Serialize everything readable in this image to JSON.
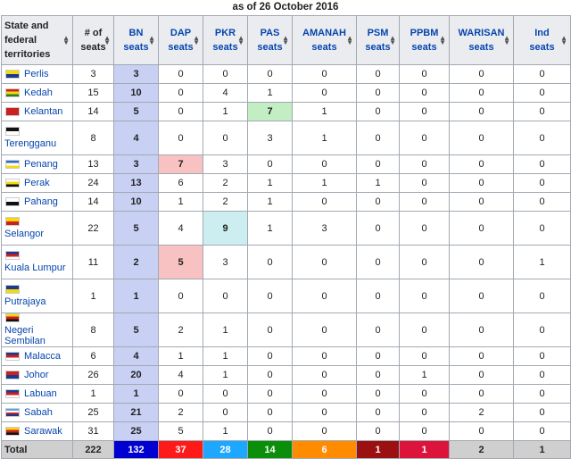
{
  "caption": "as of 26 October 2016",
  "header": {
    "state": [
      "State and",
      "federal",
      "territories"
    ],
    "num": [
      "# of",
      "seats"
    ],
    "parties": [
      {
        "key": "bn",
        "l1": "BN",
        "l2": "seats"
      },
      {
        "key": "dap",
        "l1": "DAP",
        "l2": "seats"
      },
      {
        "key": "pkr",
        "l1": "PKR",
        "l2": "seats"
      },
      {
        "key": "pas",
        "l1": "PAS",
        "l2": "seats"
      },
      {
        "key": "amanah",
        "l1": "AMANAH",
        "l2": "seats"
      },
      {
        "key": "psm",
        "l1": "PSM",
        "l2": "seats"
      },
      {
        "key": "ppbm",
        "l1": "PPBM",
        "l2": "seats"
      },
      {
        "key": "warisan",
        "l1": "WARISAN",
        "l2": "seats"
      },
      {
        "key": "ind",
        "l1": "Ind",
        "l2": "seats"
      }
    ],
    "sort_icon": "sort-arrows-icon"
  },
  "rows": [
    {
      "state": "Perlis",
      "flag": [
        "#f5d90a",
        "#1a3a8f"
      ],
      "seats": "3",
      "bn": "3",
      "dap": "0",
      "pkr": "0",
      "pas": "0",
      "amanah": "0",
      "psm": "0",
      "ppbm": "0",
      "warisan": "0",
      "ind": "0",
      "win": "bn"
    },
    {
      "state": "Kedah",
      "flag": [
        "#d22020",
        "#f5d90a",
        "#2c7d2c"
      ],
      "seats": "15",
      "bn": "10",
      "dap": "0",
      "pkr": "4",
      "pas": "1",
      "amanah": "0",
      "psm": "0",
      "ppbm": "0",
      "warisan": "0",
      "ind": "0",
      "win": "bn"
    },
    {
      "state": "Kelantan",
      "flag": [
        "#cc1f1f"
      ],
      "seats": "14",
      "bn": "5",
      "dap": "0",
      "pkr": "1",
      "pas": "7",
      "amanah": "1",
      "psm": "0",
      "ppbm": "0",
      "warisan": "0",
      "ind": "0",
      "win": "pas"
    },
    {
      "state": "Terengganu",
      "flag": [
        "#111111",
        "#ffffff"
      ],
      "seats": "8",
      "bn": "4",
      "dap": "0",
      "pkr": "0",
      "pas": "3",
      "amanah": "1",
      "psm": "0",
      "ppbm": "0",
      "warisan": "0",
      "ind": "0",
      "win": "bn",
      "tall": true
    },
    {
      "state": "Penang",
      "flag": [
        "#2f6bc4",
        "#ffffff",
        "#f5d90a"
      ],
      "seats": "13",
      "bn": "3",
      "dap": "7",
      "pkr": "3",
      "pas": "0",
      "amanah": "0",
      "psm": "0",
      "ppbm": "0",
      "warisan": "0",
      "ind": "0",
      "win": "dap"
    },
    {
      "state": "Perak",
      "flag": [
        "#ffffff",
        "#f5d90a",
        "#111111"
      ],
      "seats": "24",
      "bn": "13",
      "dap": "6",
      "pkr": "2",
      "pas": "1",
      "amanah": "1",
      "psm": "1",
      "ppbm": "0",
      "warisan": "0",
      "ind": "0",
      "win": "bn"
    },
    {
      "state": "Pahang",
      "flag": [
        "#ffffff",
        "#111111"
      ],
      "seats": "14",
      "bn": "10",
      "dap": "1",
      "pkr": "2",
      "pas": "1",
      "amanah": "0",
      "psm": "0",
      "ppbm": "0",
      "warisan": "0",
      "ind": "0",
      "win": "bn"
    },
    {
      "state": "Selangor",
      "flag": [
        "#f5d90a",
        "#cc1f1f"
      ],
      "seats": "22",
      "bn": "5",
      "dap": "4",
      "pkr": "9",
      "pas": "1",
      "amanah": "3",
      "psm": "0",
      "ppbm": "0",
      "warisan": "0",
      "ind": "0",
      "win": "pkr",
      "tall": true
    },
    {
      "state": "Kuala Lumpur",
      "flag": [
        "#1a3a8f",
        "#cc1f1f",
        "#ffffff"
      ],
      "seats": "11",
      "bn": "2",
      "dap": "5",
      "pkr": "3",
      "pas": "0",
      "amanah": "0",
      "psm": "0",
      "ppbm": "0",
      "warisan": "0",
      "ind": "1",
      "win": "dap",
      "tall": true
    },
    {
      "state": "Putrajaya",
      "flag": [
        "#1a3a8f",
        "#f5d90a"
      ],
      "seats": "1",
      "bn": "1",
      "dap": "0",
      "pkr": "0",
      "pas": "0",
      "amanah": "0",
      "psm": "0",
      "ppbm": "0",
      "warisan": "0",
      "ind": "0",
      "win": "bn",
      "tall": true
    },
    {
      "state": "Negeri Sembilan",
      "flag": [
        "#f5d90a",
        "#cc1f1f",
        "#111111"
      ],
      "seats": "8",
      "bn": "5",
      "dap": "2",
      "pkr": "1",
      "pas": "0",
      "amanah": "0",
      "psm": "0",
      "ppbm": "0",
      "warisan": "0",
      "ind": "0",
      "win": "bn",
      "tall": true
    },
    {
      "state": "Malacca",
      "flag": [
        "#1a3a8f",
        "#cc1f1f",
        "#ffffff"
      ],
      "seats": "6",
      "bn": "4",
      "dap": "1",
      "pkr": "1",
      "pas": "0",
      "amanah": "0",
      "psm": "0",
      "ppbm": "0",
      "warisan": "0",
      "ind": "0",
      "win": "bn"
    },
    {
      "state": "Johor",
      "flag": [
        "#cc1f1f",
        "#1a3a8f"
      ],
      "seats": "26",
      "bn": "20",
      "dap": "4",
      "pkr": "1",
      "pas": "0",
      "amanah": "0",
      "psm": "0",
      "ppbm": "1",
      "warisan": "0",
      "ind": "0",
      "win": "bn"
    },
    {
      "state": "Labuan",
      "flag": [
        "#1a3a8f",
        "#cc1f1f",
        "#ffffff"
      ],
      "seats": "1",
      "bn": "1",
      "dap": "0",
      "pkr": "0",
      "pas": "0",
      "amanah": "0",
      "psm": "0",
      "ppbm": "0",
      "warisan": "0",
      "ind": "0",
      "win": "bn"
    },
    {
      "state": "Sabah",
      "flag": [
        "#5aa8e6",
        "#ffffff",
        "#cc1f1f",
        "#1a3a8f"
      ],
      "seats": "25",
      "bn": "21",
      "dap": "2",
      "pkr": "0",
      "pas": "0",
      "amanah": "0",
      "psm": "0",
      "ppbm": "0",
      "warisan": "2",
      "ind": "0",
      "win": "bn"
    },
    {
      "state": "Sarawak",
      "flag": [
        "#f5d90a",
        "#cc1f1f",
        "#111111"
      ],
      "seats": "31",
      "bn": "25",
      "dap": "5",
      "pkr": "1",
      "pas": "0",
      "amanah": "0",
      "psm": "0",
      "ppbm": "0",
      "warisan": "0",
      "ind": "0",
      "win": "bn"
    }
  ],
  "total": {
    "state": "Total",
    "seats": "222",
    "bn": "132",
    "dap": "37",
    "pkr": "28",
    "pas": "14",
    "amanah": "6",
    "psm": "1",
    "ppbm": "1",
    "warisan": "2",
    "ind": "1"
  }
}
